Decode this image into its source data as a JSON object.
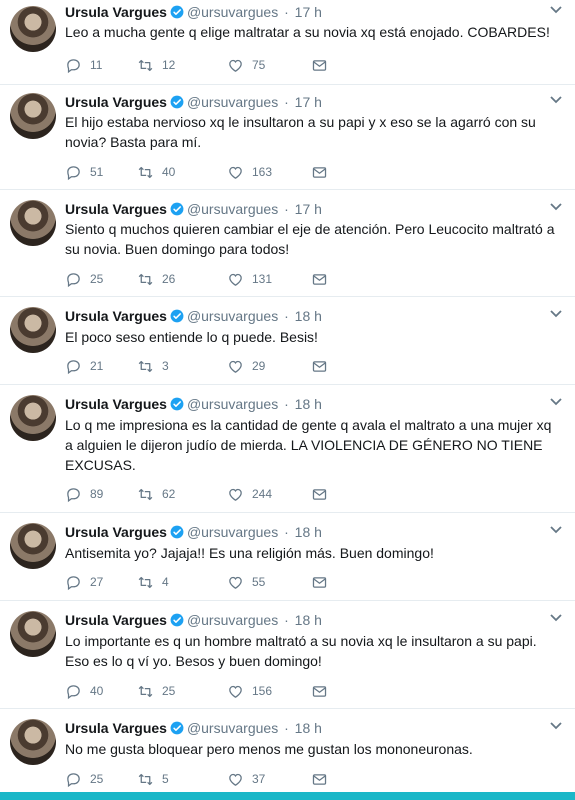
{
  "profile": {
    "name": "Ursula Vargues",
    "handle": "@ursuvargues",
    "separator": "·"
  },
  "tweets": [
    {
      "time": "17 h",
      "text": "Leo a mucha gente q elige maltratar a su novia xq está enojado. COBARDES!",
      "replies": "11",
      "retweets": "12",
      "likes": "75"
    },
    {
      "time": "17 h",
      "text": "El hijo estaba nervioso xq le insultaron a su papi y x eso se la agarró con su novia? Basta para mí.",
      "replies": "51",
      "retweets": "40",
      "likes": "163"
    },
    {
      "time": "17 h",
      "text": "Siento q muchos quieren cambiar el eje de atención. Pero Leucocito maltrató a su novia. Buen domingo para todos!",
      "replies": "25",
      "retweets": "26",
      "likes": "131"
    },
    {
      "time": "18 h",
      "text": "El poco seso entiende lo q puede.  Besis!",
      "replies": "21",
      "retweets": "3",
      "likes": "29"
    },
    {
      "time": "18 h",
      "text": "Lo q me impresiona es la cantidad de gente q avala el maltrato a una mujer xq a alguien le dijeron judío de mierda. LA VIOLENCIA DE GÉNERO NO TIENE EXCUSAS.",
      "replies": "89",
      "retweets": "62",
      "likes": "244"
    },
    {
      "time": "18 h",
      "text": "Antisemita yo? Jajaja!! Es una religión más. Buen domingo!",
      "replies": "27",
      "retweets": "4",
      "likes": "55"
    },
    {
      "time": "18 h",
      "text": "Lo importante es q un hombre maltrató a su novia xq le insultaron a su papi. Eso es lo q ví yo. Besos y buen domingo!",
      "replies": "40",
      "retweets": "25",
      "likes": "156"
    },
    {
      "time": "18 h",
      "text": "No me gusta bloquear pero menos me gustan los mononeuronas.",
      "replies": "25",
      "retweets": "5",
      "likes": "37"
    }
  ],
  "icons": {
    "reply": "reply-icon",
    "retweet": "retweet-icon",
    "like": "heart-icon",
    "dm": "envelope-icon",
    "verified": "verified-badge-icon",
    "caret": "chevron-down-icon"
  },
  "colors": {
    "verified": "#1da1f2",
    "muted": "#657786",
    "text": "#14171a",
    "bottom_band": "#1ab7c8"
  }
}
